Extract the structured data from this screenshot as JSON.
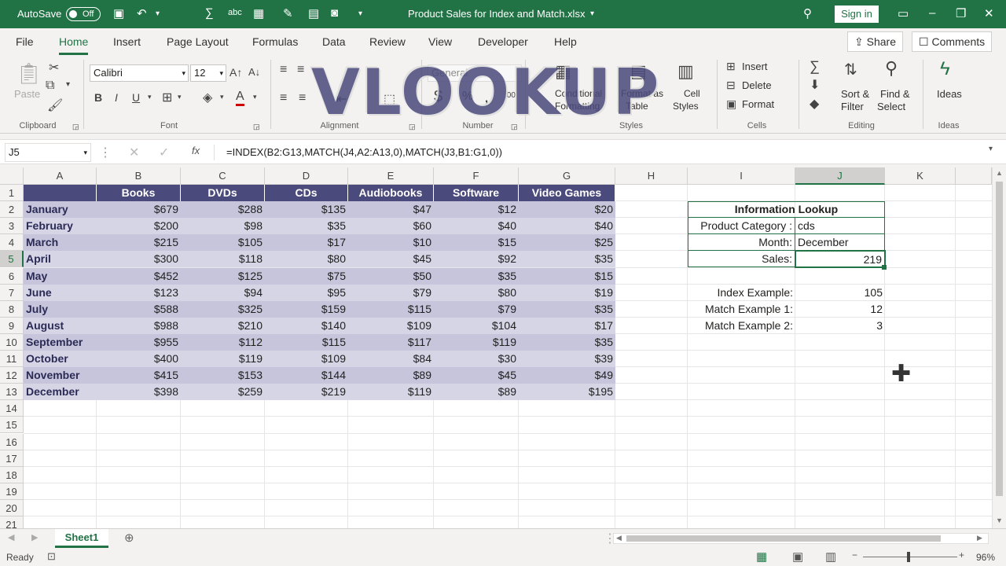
{
  "titlebar": {
    "autosave_label": "AutoSave",
    "autosave_state": "Off",
    "filename": "Product Sales for Index and Match.xlsx",
    "signin_label": "Sign in"
  },
  "tabs": [
    "File",
    "Home",
    "Insert",
    "Page Layout",
    "Formulas",
    "Data",
    "Review",
    "View",
    "Developer",
    "Help"
  ],
  "share_label": "Share",
  "comments_label": "Comments",
  "ribbon": {
    "paste_label": "Paste",
    "font_name": "Calibri",
    "font_size": "12",
    "number_format": "General",
    "group_labels": [
      "Clipboard",
      "Font",
      "Alignment",
      "Number",
      "Styles",
      "Cells",
      "Editing",
      "Ideas"
    ],
    "insert_label": "Insert",
    "delete_label": "Delete",
    "format_label": "Format",
    "sort_label": "Sort &",
    "filter_label": "Filter",
    "find_label": "Find &",
    "select_label": "Select",
    "ideas_label": "Ideas",
    "conditional_label": "Conditional",
    "formatting_label": "Formatting",
    "format_as_label": "Format as",
    "table_label": "Table",
    "cell_label": "Cell",
    "styles_label": "Styles"
  },
  "overlay_text": "VLOOKUP",
  "formula_bar": {
    "name_box": "J5",
    "formula": "=INDEX(B2:G13,MATCH(J4,A2:A13,0),MATCH(J3,B1:G1,0))"
  },
  "columns": [
    "A",
    "B",
    "C",
    "D",
    "E",
    "F",
    "G",
    "H",
    "I",
    "J",
    "K"
  ],
  "rows": [
    "1",
    "2",
    "3",
    "4",
    "5",
    "6",
    "7",
    "8",
    "9",
    "10",
    "11",
    "12",
    "13",
    "14",
    "15",
    "16",
    "17",
    "18",
    "19",
    "20",
    "21"
  ],
  "table": {
    "headers": [
      "",
      "Books",
      "DVDs",
      "CDs",
      "Audiobooks",
      "Software",
      "Video Games"
    ],
    "rows": [
      [
        "January",
        "$679",
        "$288",
        "$135",
        "$47",
        "$12",
        "$20"
      ],
      [
        "February",
        "$200",
        "$98",
        "$35",
        "$60",
        "$40",
        "$40"
      ],
      [
        "March",
        "$215",
        "$105",
        "$17",
        "$10",
        "$15",
        "$25"
      ],
      [
        "April",
        "$300",
        "$118",
        "$80",
        "$45",
        "$92",
        "$35"
      ],
      [
        "May",
        "$452",
        "$125",
        "$75",
        "$50",
        "$35",
        "$15"
      ],
      [
        "June",
        "$123",
        "$94",
        "$95",
        "$79",
        "$80",
        "$19"
      ],
      [
        "July",
        "$588",
        "$325",
        "$159",
        "$115",
        "$79",
        "$35"
      ],
      [
        "August",
        "$988",
        "$210",
        "$140",
        "$109",
        "$104",
        "$17"
      ],
      [
        "September",
        "$955",
        "$112",
        "$115",
        "$117",
        "$119",
        "$35"
      ],
      [
        "October",
        "$400",
        "$119",
        "$109",
        "$84",
        "$30",
        "$39"
      ],
      [
        "November",
        "$415",
        "$153",
        "$144",
        "$89",
        "$45",
        "$49"
      ],
      [
        "December",
        "$398",
        "$259",
        "$219",
        "$119",
        "$89",
        "$195"
      ]
    ]
  },
  "lookup": {
    "title": "Information Lookup",
    "category_label": "Product Category :",
    "category_value": "cds",
    "month_label": "Month:",
    "month_value": "December",
    "sales_label": "Sales:",
    "sales_value": "219",
    "index_label": "Index Example:",
    "index_value": "105",
    "match1_label": "Match Example 1:",
    "match1_value": "12",
    "match2_label": "Match Example 2:",
    "match2_value": "3"
  },
  "sheet_tab": "Sheet1",
  "status": {
    "ready": "Ready",
    "zoom": "96%"
  },
  "colors": {
    "excel_green": "#217346",
    "header_purple": "#4b4a7c",
    "band": "#c6c5dc"
  }
}
